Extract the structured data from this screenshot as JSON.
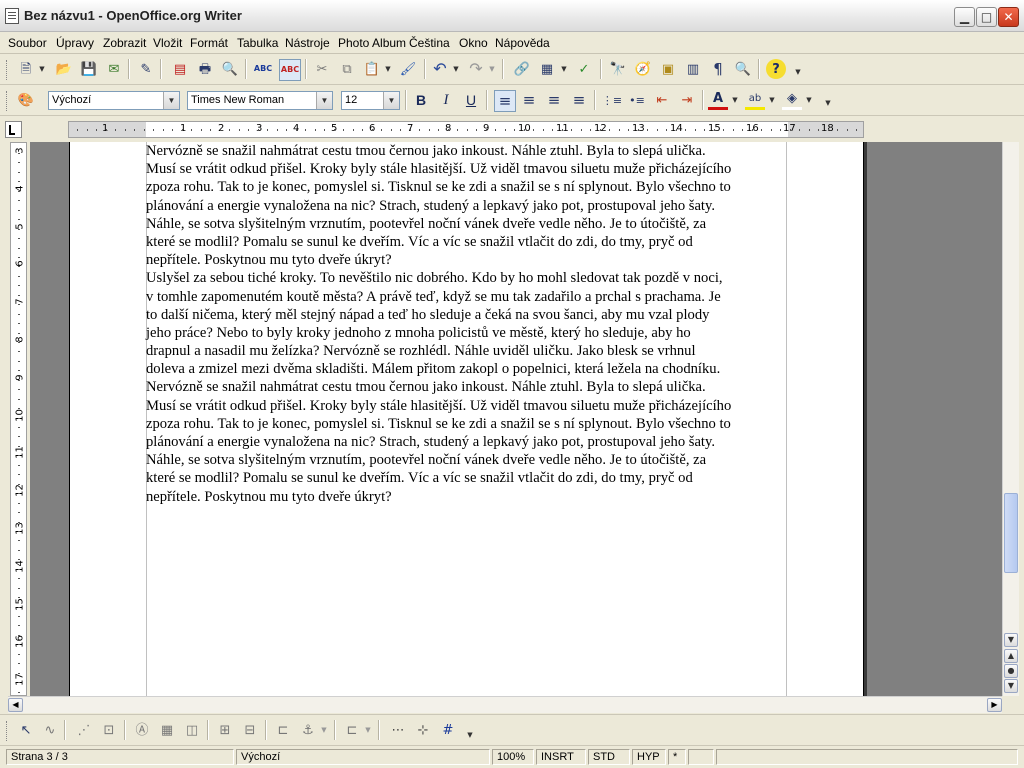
{
  "window": {
    "title": "Bez názvu1 - OpenOffice.org Writer",
    "minimize_glyph": "▁",
    "maximize_glyph": "□",
    "close_glyph": "✕"
  },
  "menu": [
    "Soubor",
    "Úpravy",
    "Zobrazit",
    "Vložit",
    "Formát",
    "Tabulka",
    "Nástroje",
    "Photo Album",
    "Čeština",
    "Okno",
    "Nápověda"
  ],
  "formatting": {
    "style": "Výchozí",
    "font": "Times New Roman",
    "size": "12"
  },
  "icons": {
    "new": "🗎",
    "open": "📂",
    "save": "💾",
    "email": "✉",
    "edit": "✎",
    "pdf": "▤",
    "print": "🖶",
    "preview": "🔍",
    "spellcheck": "ABC",
    "autospell": "ABC",
    "cut": "✂",
    "copy": "⧉",
    "paste": "📋",
    "format_paint": "🖌",
    "undo": "↶",
    "redo": "↷",
    "hyperlink": "🔗",
    "table": "▦",
    "show_draw": "✓",
    "find": "🔭",
    "navigator": "🧭",
    "gallery": "▣",
    "datasource": "▥",
    "nonprint": "¶",
    "zoom": "🔍",
    "help": "?",
    "styles": "🎨",
    "bold": "B",
    "italic": "I",
    "underline": "U",
    "align_left": "≡",
    "align_center": "≡",
    "align_right": "≡",
    "justify": "≡",
    "numbering": "⋮≡",
    "bullets": "•≡",
    "indent_dec": "⇤",
    "indent_inc": "⇥",
    "font_color": "A",
    "highlight": "ab",
    "bg_color": "◈",
    "select": "↖",
    "curve": "∿",
    "points": "⋰",
    "text_frame": "⊡",
    "fontwork": "Ⓐ",
    "from_file": "▦",
    "extrusion": "◫",
    "align": "⊞",
    "arrange": "⊟",
    "anchor": "⚓",
    "wrap": "⊏",
    "grid": "⋯",
    "helplines": "⊹",
    "snap": "#"
  },
  "ruler": {
    "h_labels": [
      "1",
      "1",
      "2",
      "3",
      "4",
      "5",
      "6",
      "7",
      "8",
      "9",
      "10",
      "11",
      "12",
      "13",
      "14",
      "15",
      "16",
      "17",
      "18"
    ],
    "v_labels": [
      "3",
      "4",
      "5",
      "6",
      "7",
      "8",
      "9",
      "10",
      "11",
      "12",
      "13",
      "14",
      "15",
      "16",
      "17"
    ]
  },
  "document": {
    "lines": [
      "Nervózně se snažil nahmátrat cestu tmou černou jako inkoust. Náhle ztuhl. Byla to slepá ulička.",
      "Musí se vrátit odkud přišel. Kroky byly stále hlasitější. Už viděl tmavou siluetu muže přicházejícího",
      "zpoza rohu. Tak to je konec, pomyslel si. Tisknul se ke zdi a snažil se s ní splynout. Bylo všechno to",
      "plánování a energie vynaložena na nic? Strach, studený a lepkavý jako pot, prostupoval jeho šaty.",
      "Náhle, se sotva slyšitelným vrznutím, pootevřel noční vánek dveře vedle něho. Je to útočiště, za",
      "které se modlil? Pomalu se sunul ke dveřím. Víc a víc se snažil vtlačit do zdi, do tmy, pryč od",
      "nepřítele. Poskytnou mu tyto dveře úkryt?",
      "Uslyšel za sebou tiché kroky. To nevěštilo nic dobrého. Kdo by ho mohl sledovat tak pozdě v noci,",
      "v tomhle zapomenutém koutě města? A právě teď, když se mu tak zadařilo a prchal s prachama. Je",
      "to další ničema, který měl stejný nápad a teď ho sleduje a čeká na svou šanci, aby mu vzal plody",
      "jeho práce? Nebo to byly kroky jednoho z mnoha policistů ve městě, který ho sleduje, aby ho",
      "drapnul a nasadil mu želízka? Nervózně se rozhlédl. Náhle uviděl uličku. Jako blesk se vrhnul",
      "doleva a zmizel mezi dvěma skladišti. Málem přitom zakopl o popelnici, která ležela na chodníku.",
      "Nervózně se snažil nahmátrat cestu tmou černou jako inkoust. Náhle ztuhl. Byla to slepá ulička.",
      "Musí se vrátit odkud přišel. Kroky byly stále hlasitější. Už viděl tmavou siluetu muže přicházejícího",
      "zpoza rohu. Tak to je konec, pomyslel si. Tisknul se ke zdi a snažil se s ní splynout. Bylo všechno to",
      "plánování a energie vynaložena na nic? Strach, studený a lepkavý jako pot, prostupoval jeho šaty.",
      "Náhle, se sotva slyšitelným vrznutím, pootevřel noční vánek dveře vedle něho. Je to útočiště, za",
      "které se modlil? Pomalu se sunul ke dveřím. Víc a víc se snažil vtlačit do zdi, do tmy, pryč od",
      "nepřítele. Poskytnou mu tyto dveře úkryt?"
    ]
  },
  "status": {
    "page": "Strana 3 / 3",
    "style": "Výchozí",
    "zoom": "100%",
    "insert": "INSRT",
    "selection": "STD",
    "hyphen": "HYP",
    "modified": "*"
  }
}
